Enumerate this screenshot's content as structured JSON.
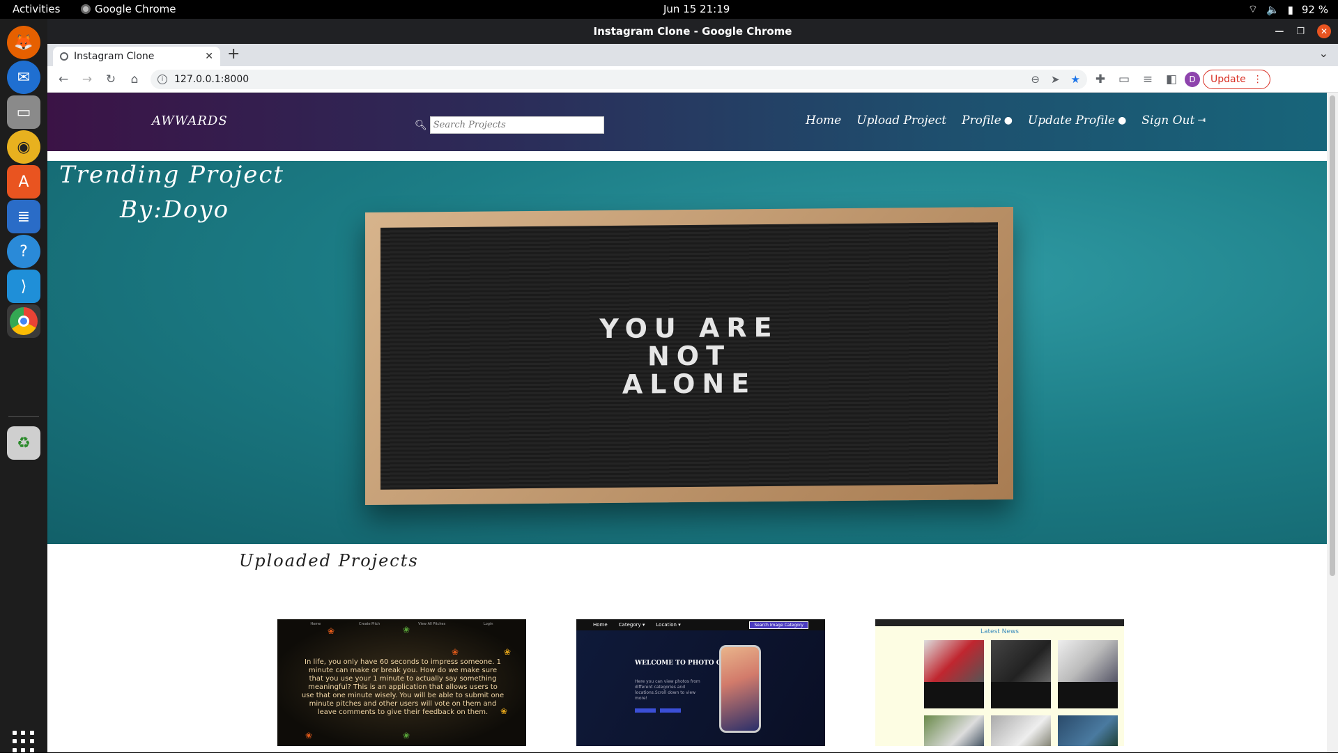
{
  "topbar": {
    "activities": "Activities",
    "app_name": "Google Chrome",
    "datetime": "Jun 15  21:19",
    "battery": "92 %"
  },
  "dock": {
    "items": [
      "firefox-icon",
      "thunderbird-icon",
      "files-icon",
      "rhythmbox-icon",
      "software-icon",
      "writer-icon",
      "help-icon",
      "vscode-icon",
      "chrome-icon",
      "trash-icon"
    ]
  },
  "window": {
    "title": "Instagram Clone - Google Chrome"
  },
  "tabs": [
    {
      "label": "Instagram Clone"
    }
  ],
  "toolbar": {
    "url": "127.0.0.1:8000",
    "avatar_letter": "D",
    "update_label": "Update"
  },
  "site": {
    "brand": "AWWARDS",
    "search_placeholder": "Search Projects",
    "nav": {
      "home": "Home",
      "upload": "Upload Project",
      "profile": "Profile",
      "update_profile": "Update Profile",
      "sign_out": "Sign Out"
    },
    "hero": {
      "title": "Trending Project",
      "by": "By:Doyo",
      "board_lines": [
        "YOU ARE",
        "NOT",
        "ALONE"
      ]
    },
    "section_title": "Uploaded Projects",
    "cards": {
      "card1_nav": [
        "Home",
        "Create Pitch",
        "View All Pitches",
        "Login"
      ],
      "card1_text": "In life, you only have 60 seconds to impress someone. 1 minute can make or break you. How do we make sure that you use your 1 minute to actually say something meaningful? This is an application that allows users to use that one minute wisely. You will be able to submit one minute pitches and other users will vote on them and leave comments to give their feedback on them.",
      "card2_nav": [
        "Home",
        "Category ▾",
        "Location ▾"
      ],
      "card2_search": "Search Image Category",
      "card2_welcome": "WELCOME TO PHOTO GALLERY",
      "card2_sub": "Here you can view photos from different categories and locations.Scroll down to view more!",
      "card3_title": "Latest News"
    }
  }
}
